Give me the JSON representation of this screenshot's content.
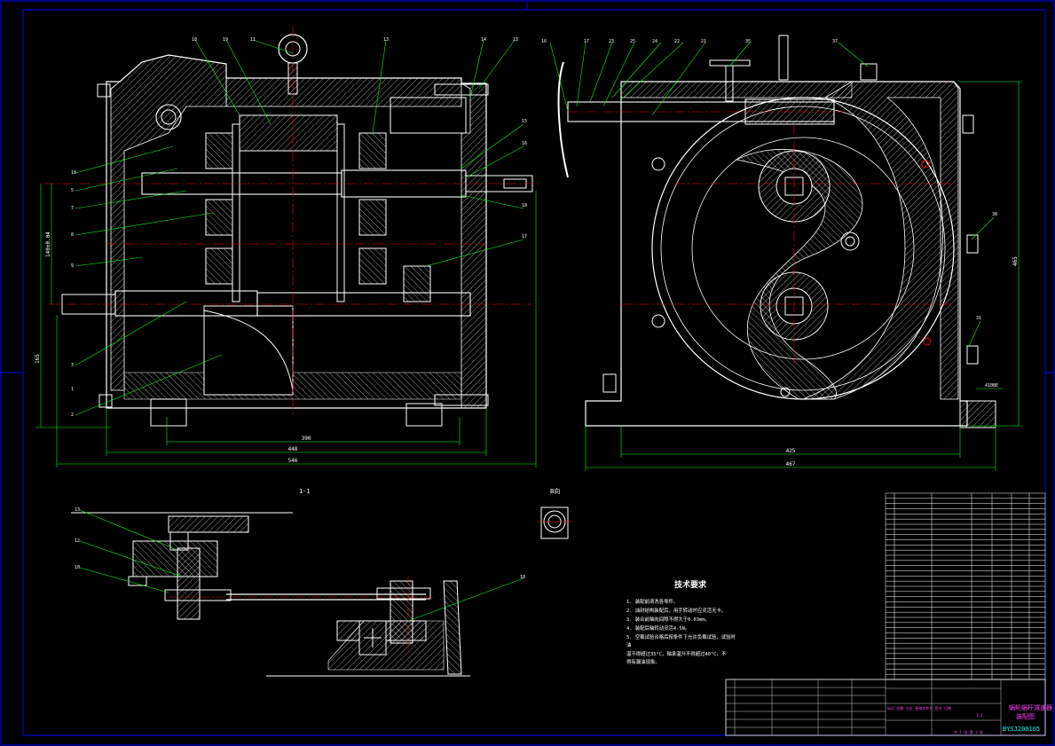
{
  "drawing": {
    "colors": {
      "background": "#000000",
      "frame": "#0000ff",
      "geometry": "#ffffff",
      "dimension": "#00ff00",
      "centerline": "#ff0000",
      "title_block_text": "#ff40ff",
      "drawing_number": "#00ffff"
    },
    "section_label": "1-1",
    "detail_label": "B向",
    "dims": {
      "front_width_inner": "390",
      "front_width_mid": "448",
      "front_width_outer": "546",
      "front_height_left": "165",
      "front_height_upper": "140±0.04",
      "side_width_inner": "425",
      "side_width_outer": "467",
      "side_height": "465",
      "side_note_right": "410BE"
    },
    "balloons_front": [
      "18",
      "19",
      "11",
      "13",
      "14",
      "13",
      "15",
      "16",
      "10",
      "17",
      "18",
      "5",
      "7",
      "8",
      "9",
      "3",
      "2",
      "1"
    ],
    "balloons_side": [
      "16",
      "17",
      "23",
      "25",
      "24",
      "22",
      "21",
      "35",
      "37",
      "38",
      "31"
    ],
    "balloons_section": [
      "13",
      "12",
      "10",
      "18"
    ],
    "technical_requirements": {
      "title": "技术要求",
      "items": [
        "1. 装配前清洗各零件。",
        "2. 油封结构装配后，用手转动时应灵活无卡。",
        "3. 装合前轴向间隙不得大于0.03mm。",
        "4. 装配后轴转动灵活4-5N。",
        "5. 空载试验合格后按条件下允许负载试验，试验时",
        "   油",
        "   温不得超过35°C，轴承温升不得超过40°C，不",
        "   得有漏油现象。"
      ]
    },
    "title_block": {
      "drawing_number": "BYSJ200105",
      "designation": "蜗轮蜗杆减速器",
      "subtitle": "装配图",
      "sheet_info": "共 1 张 第 1 张",
      "scale": "1:2",
      "weight": "",
      "material_row": "标记 处数 分区 更改文件号 签名 日期"
    }
  }
}
